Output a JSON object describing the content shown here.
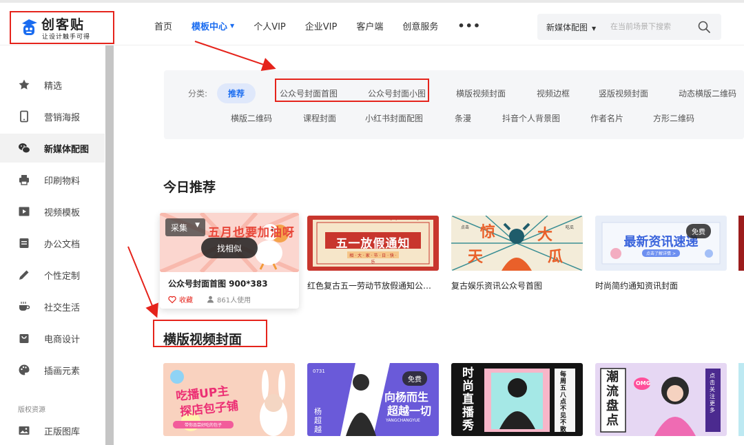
{
  "logo": {
    "title": "创客贴",
    "slogan": "让设计触手可得"
  },
  "nav": [
    {
      "label": "首页",
      "active": false
    },
    {
      "label": "模板中心",
      "active": true,
      "has_dropdown": true
    },
    {
      "label": "个人VIP",
      "active": false
    },
    {
      "label": "企业VIP",
      "active": false
    },
    {
      "label": "客户端",
      "active": false
    },
    {
      "label": "创意服务",
      "active": false
    }
  ],
  "search": {
    "scene": "新媒体配图",
    "placeholder": "在当前场景下搜索"
  },
  "sidebar": {
    "items": [
      {
        "label": "精选",
        "icon": "star-icon"
      },
      {
        "label": "营销海报",
        "icon": "phone-icon"
      },
      {
        "label": "新媒体配图",
        "icon": "wechat-icon",
        "active": true
      },
      {
        "label": "印刷物料",
        "icon": "printer-icon"
      },
      {
        "label": "视频模板",
        "icon": "video-icon"
      },
      {
        "label": "办公文档",
        "icon": "document-icon"
      },
      {
        "label": "个性定制",
        "icon": "pencil-icon"
      },
      {
        "label": "社交生活",
        "icon": "coffee-icon"
      },
      {
        "label": "电商设计",
        "icon": "shopping-bag-icon"
      },
      {
        "label": "插画元素",
        "icon": "palette-icon"
      }
    ],
    "section_label": "版权资源",
    "extra_item": {
      "label": "正版图库",
      "icon": "image-icon"
    }
  },
  "categories": {
    "label": "分类:",
    "row1": [
      "推荐",
      "公众号封面首图",
      "公众号封面小图",
      "横版视频封面",
      "视频边框",
      "竖版视频封面",
      "动态横版二维码"
    ],
    "row2": [
      "横版二维码",
      "课程封面",
      "小红书封面配图",
      "条漫",
      "抖音个人背景图",
      "作者名片",
      "方形二维码"
    ]
  },
  "today": {
    "title": "今日推荐",
    "hover_card": {
      "title": "公众号封面首图 900*383",
      "collect_label": "采集",
      "similar_label": "找相似",
      "fav_label": "收藏",
      "uses_label": "861人使用",
      "art_text": "五月也要加油呀"
    },
    "cards": [
      {
        "title": "红色复古五一劳动节放假通知公众号首图",
        "art_main": "五一放假通知",
        "art_sub": "相 · 大 · 家 · 节 · 日 · 快 · 乐",
        "art_pinyin": "Wu Yi Fang Jia Tong Zhi"
      },
      {
        "title": "复古娱乐资讯公众号首图",
        "art_left_a": "惊",
        "art_left_b": "天",
        "art_right_a": "大",
        "art_right_b": "瓜",
        "art_tag_a": "点击",
        "art_tag_b": "吃瓜"
      },
      {
        "title": "时尚简约通知资讯封面",
        "badge": "免费",
        "art_main": "最新资讯速递",
        "art_sub": "点击了解详情 >"
      }
    ]
  },
  "horizontal": {
    "title": "横版视频封面",
    "cards": [
      {
        "art_main": "吃播UP主",
        "art_sub": "探店包子铺",
        "art_caption": "带你品尝好吃的包子"
      },
      {
        "badge": "免费",
        "art_code": "0731",
        "art_main": "向杨而生",
        "art_sub": "超越一切",
        "art_name": "YANGCHANGYUE",
        "art_side": "杨 超 越"
      },
      {
        "art_main": "时尚直播秀",
        "art_side": "每周五八点不见不散"
      },
      {
        "art_main": "潮流盘点",
        "art_tag": "OMG",
        "art_side": "点击关注更多"
      }
    ]
  }
}
